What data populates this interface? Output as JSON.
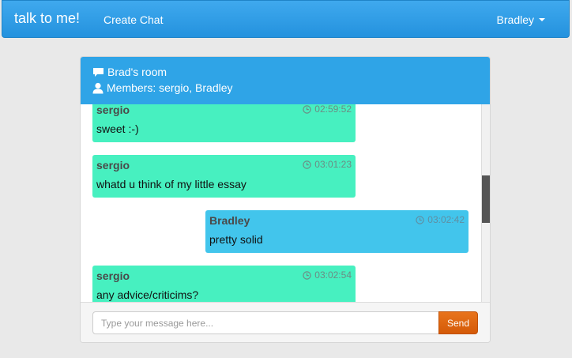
{
  "navbar": {
    "brand": "talk to me!",
    "create_chat": "Create Chat",
    "user": "Bradley"
  },
  "room": {
    "name": "Brad's room",
    "members_label": "Members: sergio, Bradley"
  },
  "messages": [
    {
      "author": "sergio",
      "time": "02:59:52",
      "text": "sweet :-)",
      "from_self": false
    },
    {
      "author": "sergio",
      "time": "03:01:23",
      "text": "whatd u think of my little essay",
      "from_self": false
    },
    {
      "author": "Bradley",
      "time": "03:02:42",
      "text": "pretty solid",
      "from_self": true
    },
    {
      "author": "sergio",
      "time": "03:02:54",
      "text": "any advice/criticims?",
      "from_self": false
    }
  ],
  "composer": {
    "placeholder": "Type your message here...",
    "value": "",
    "send_label": "Send"
  },
  "icons": {
    "room": "comment-icon",
    "members": "user-icon",
    "timestamp": "clock-icon",
    "user_menu": "caret-down-icon"
  },
  "colors": {
    "navbar": "#2fa4e7",
    "other_message": "#47f0c0",
    "self_message": "#42c5ec",
    "send_button": "#dd5600"
  }
}
